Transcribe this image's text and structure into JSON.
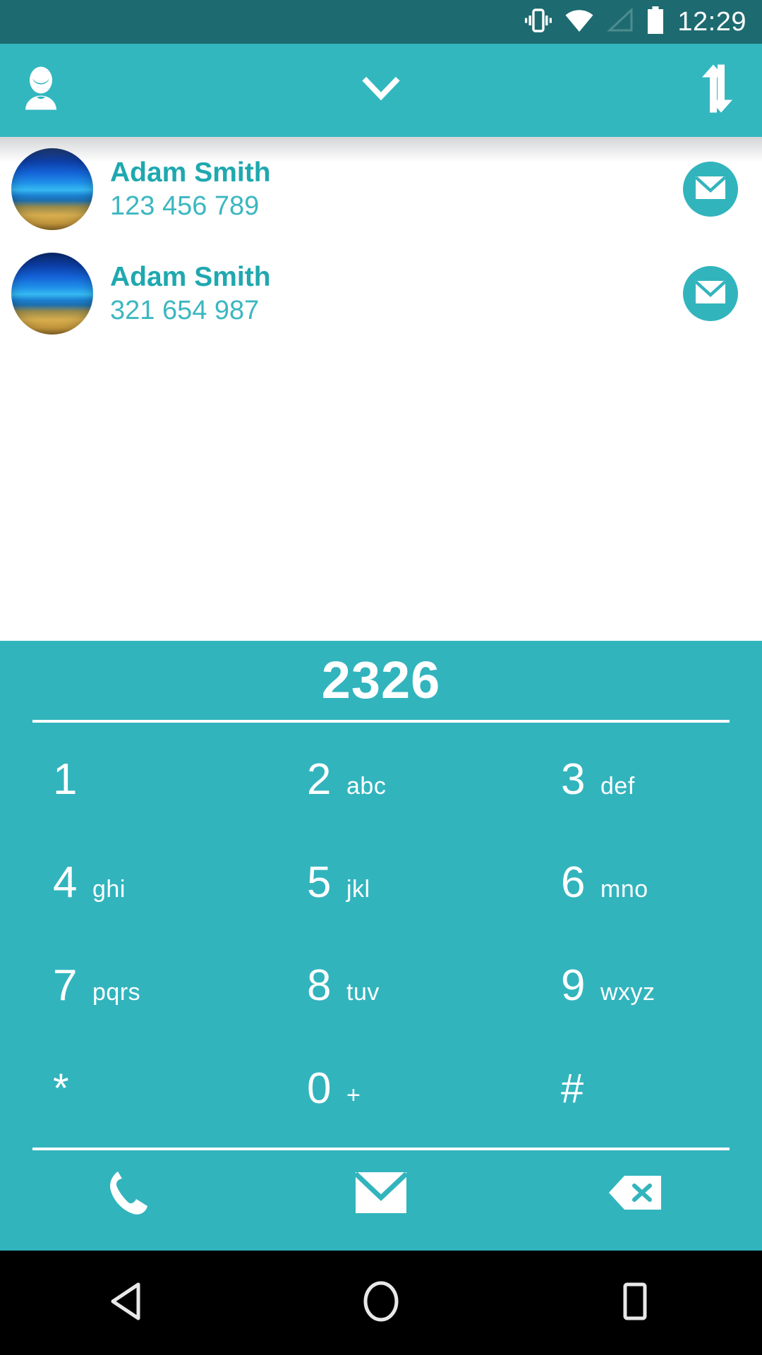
{
  "status_bar": {
    "time": "12:29",
    "icons": [
      "vibrate-icon",
      "wifi-icon",
      "signal-icon",
      "battery-icon"
    ],
    "background_color": "#1d6b70"
  },
  "app_bar": {
    "background_color": "#33b7bf",
    "left_icon": "person-icon",
    "center_icon": "chevron-down-icon",
    "right_icon": "sort-arrows-icon"
  },
  "contacts": {
    "rows": [
      {
        "name": "Adam Smith",
        "number": "123 456 789",
        "avatar": "beach-photo-avatar",
        "action_icon": "envelope-icon"
      },
      {
        "name": "Adam Smith",
        "number": "321 654 987",
        "avatar": "beach-photo-avatar",
        "action_icon": "envelope-icon"
      }
    ],
    "name_color": "#1fa8af",
    "number_color": "#3cb7c0"
  },
  "dialer": {
    "background_color": "#32b4bd",
    "entered_number": "2326",
    "keys": [
      {
        "digit": "1",
        "letters": ""
      },
      {
        "digit": "2",
        "letters": "abc"
      },
      {
        "digit": "3",
        "letters": "def"
      },
      {
        "digit": "4",
        "letters": "ghi"
      },
      {
        "digit": "5",
        "letters": "jkl"
      },
      {
        "digit": "6",
        "letters": "mno"
      },
      {
        "digit": "7",
        "letters": "pqrs"
      },
      {
        "digit": "8",
        "letters": "tuv"
      },
      {
        "digit": "9",
        "letters": "wxyz"
      },
      {
        "digit": "*",
        "letters": ""
      },
      {
        "digit": "0",
        "letters": "+"
      },
      {
        "digit": "#",
        "letters": ""
      }
    ],
    "actions": [
      {
        "icon": "phone-call-icon"
      },
      {
        "icon": "envelope-icon"
      },
      {
        "icon": "backspace-icon"
      }
    ]
  },
  "nav_bar": {
    "background_color": "#000000",
    "buttons": [
      {
        "icon": "back-triangle-icon"
      },
      {
        "icon": "home-circle-icon"
      },
      {
        "icon": "recents-square-icon"
      }
    ]
  }
}
